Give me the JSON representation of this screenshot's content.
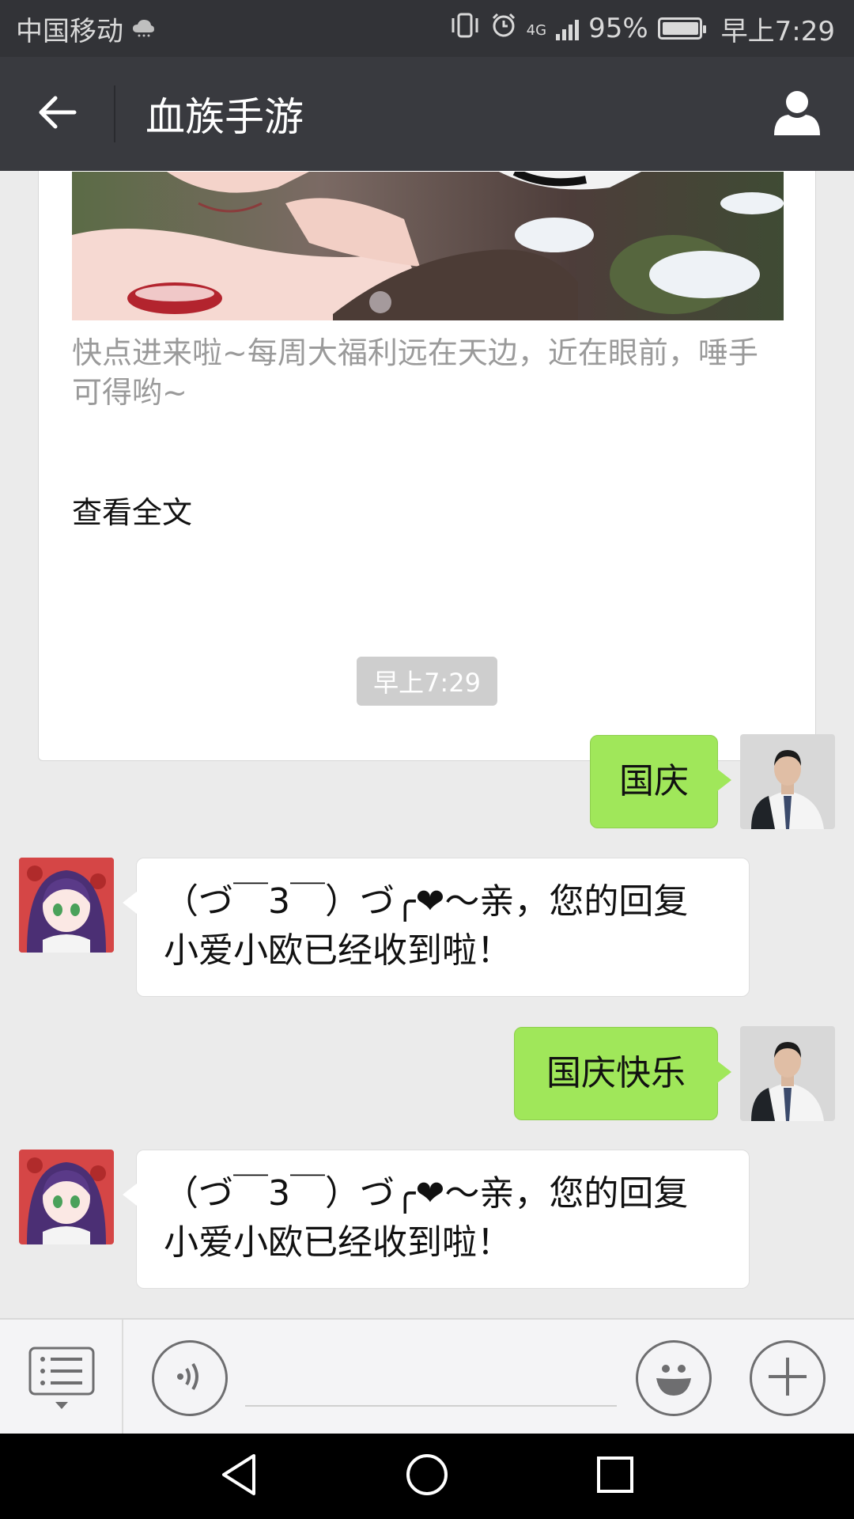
{
  "status_bar": {
    "carrier": "中国移动",
    "network": "4G",
    "battery": "95%",
    "time": "早上7:29"
  },
  "header": {
    "title": "血族手游",
    "back_icon": "arrow-left-icon",
    "profile_icon": "person-icon"
  },
  "article": {
    "description": "快点进来啦~每周大福利远在天边，近在眼前，唾手可得哟~",
    "read_more": "查看全文"
  },
  "timestamp": "早上7:29",
  "messages": [
    {
      "side": "sent",
      "text": "国庆"
    },
    {
      "side": "received",
      "text": "（づ￣3￣）づ╭❤～亲，您的回复小爱小欧已经收到啦！"
    },
    {
      "side": "sent",
      "text": "国庆快乐"
    },
    {
      "side": "received",
      "text": "（づ￣3￣）づ╭❤～亲，您的回复小爱小欧已经收到啦！"
    }
  ],
  "input_bar": {
    "menu_icon": "menu-list-icon",
    "voice_icon": "voice-icon",
    "emoji_icon": "emoji-icon",
    "add_icon": "plus-icon",
    "placeholder": ""
  },
  "nav": {
    "back_icon": "triangle-back-icon",
    "home_icon": "circle-home-icon",
    "recent_icon": "square-recent-icon"
  },
  "colors": {
    "status_bg": "#323337",
    "header_bg": "#393a3f",
    "chat_bg": "#ebebeb",
    "sent_bubble": "#a0e75a",
    "received_bubble": "#ffffff"
  }
}
